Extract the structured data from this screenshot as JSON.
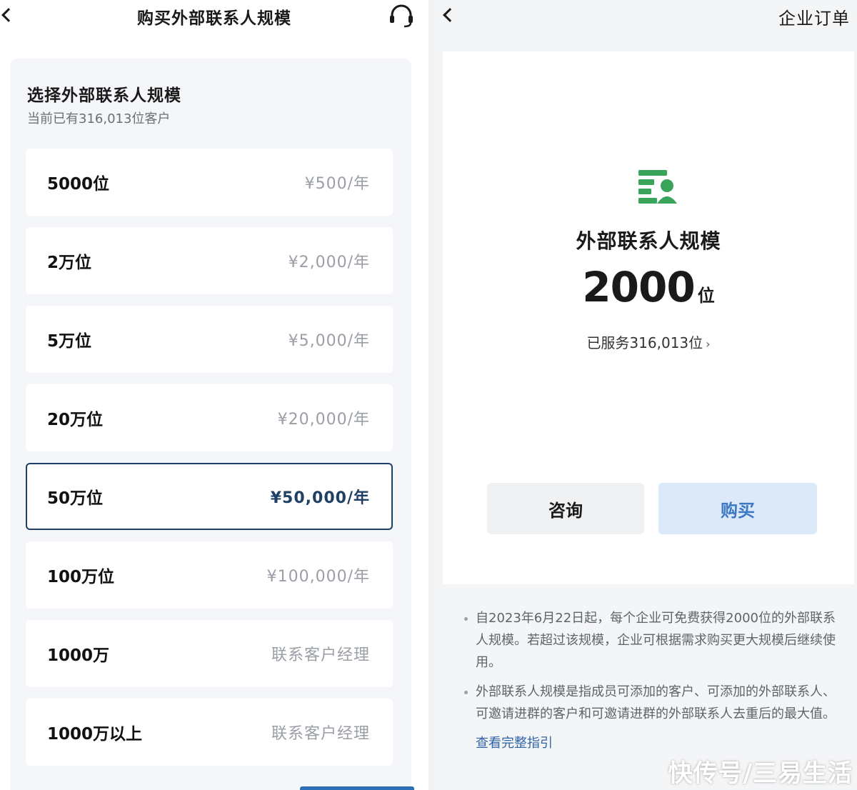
{
  "left": {
    "title": "购买外部联系人规模",
    "section_title": "选择外部联系人规模",
    "section_sub": "当前已有316,013位客户",
    "options": [
      {
        "label": "5000位",
        "price": "¥500/年"
      },
      {
        "label": "2万位",
        "price": "¥2,000/年"
      },
      {
        "label": "5万位",
        "price": "¥5,000/年"
      },
      {
        "label": "20万位",
        "price": "¥20,000/年"
      },
      {
        "label": "50万位",
        "price": "¥50,000/年"
      },
      {
        "label": "100万位",
        "price": "¥100,000/年"
      },
      {
        "label": "1000万",
        "price": "联系客户经理"
      },
      {
        "label": "1000万以上",
        "price": "联系客户经理"
      }
    ],
    "selected_index": 4
  },
  "right": {
    "order_label": "企业订单",
    "title": "外部联系人规模",
    "quota_number": "2000",
    "quota_unit": "位",
    "served": "已服务316,013位",
    "served_arrow": "›",
    "consult_label": "咨询",
    "buy_label": "购买",
    "notes": [
      "自2023年6月22日起，每个企业可免费获得2000位的外部联系人规模。若超过该规模，企业可根据需求购买更大规模后继续使用。",
      "外部联系人规模是指成员可添加的客户、可添加的外部联系人、可邀请进群的客户和可邀请进群的外部联系人去重后的最大值。"
    ],
    "guide_link": "查看完整指引"
  },
  "watermark": "快传号/三易生活",
  "colors": {
    "selected_border": "#1f3f66",
    "buy_bg": "#dbe9f8",
    "buy_text": "#3c78c5",
    "logo_green": "#3aa55a",
    "link": "#2f64a8"
  },
  "icons": {
    "back": "chevron-left-icon",
    "support": "headset-icon",
    "logo": "contact-scale-icon"
  }
}
